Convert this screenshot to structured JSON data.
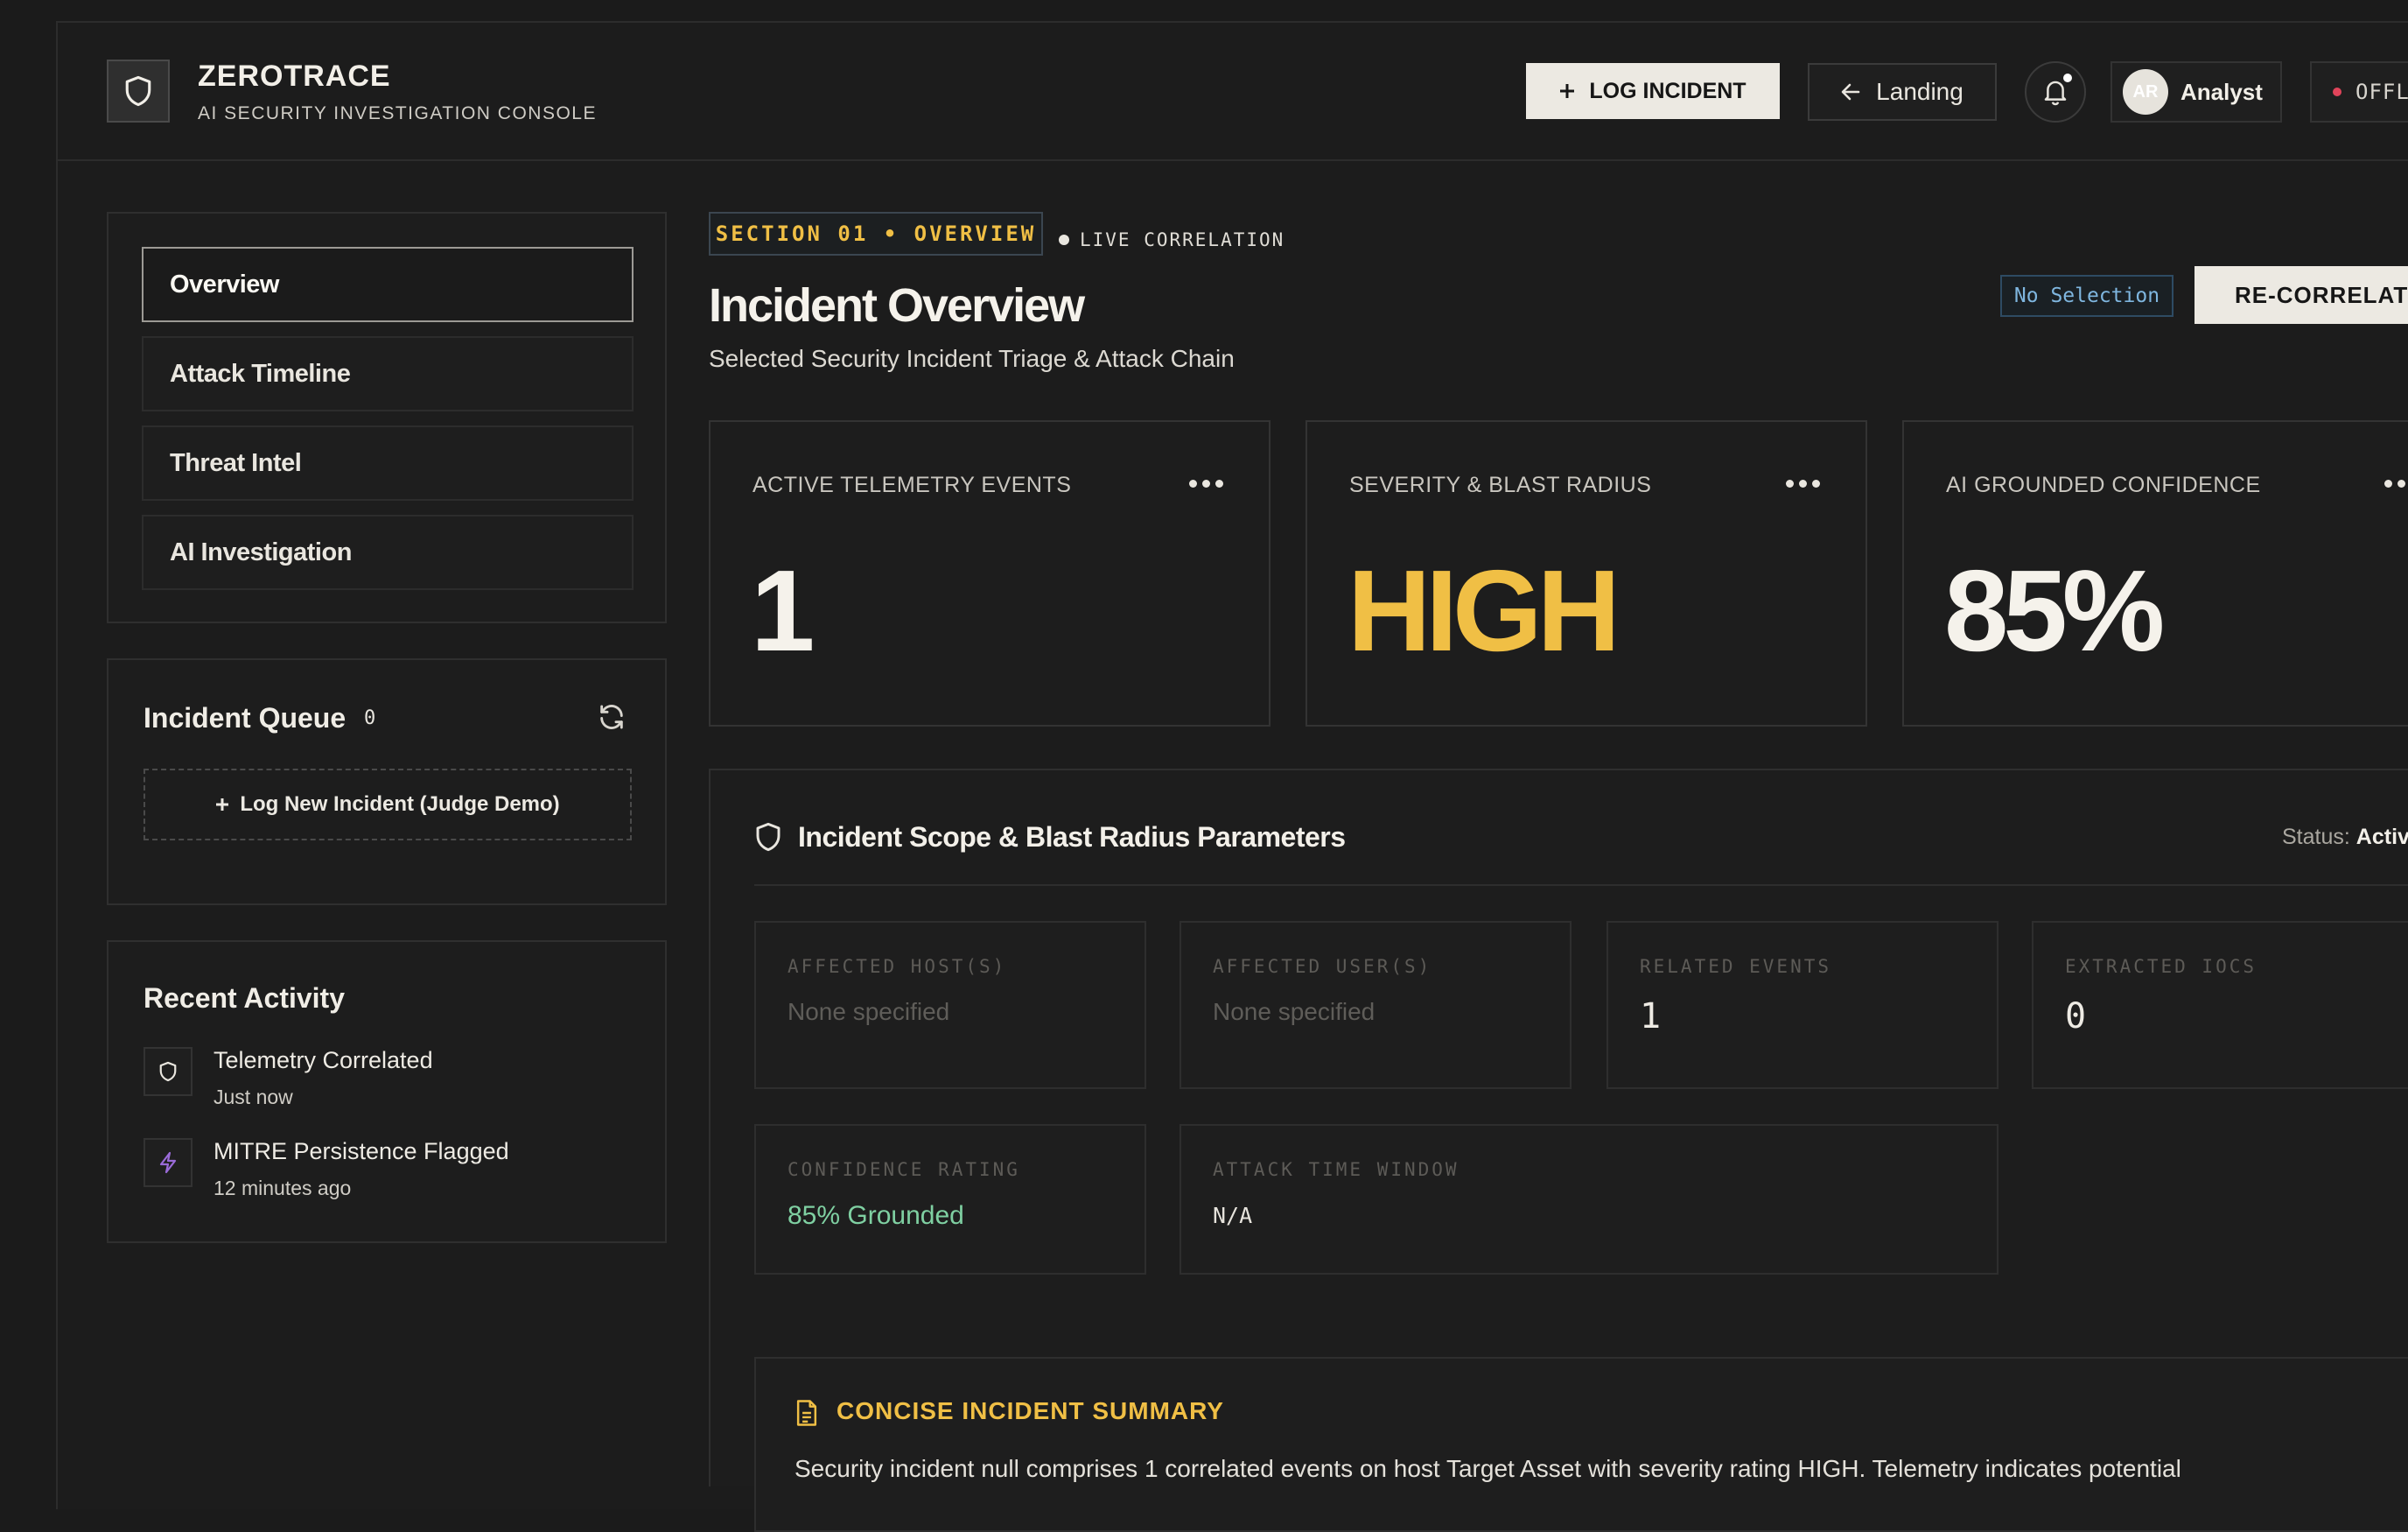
{
  "header": {
    "brand_title": "ZEROTRACE",
    "brand_subtitle": "AI SECURITY INVESTIGATION CONSOLE",
    "log_incident_label": "LOG INCIDENT",
    "landing_label": "Landing",
    "avatar_initials": "AR",
    "user_name": "Analyst",
    "status_label": "OFFLINE"
  },
  "sidebar": {
    "nav_items": [
      {
        "label": "Overview",
        "active": true
      },
      {
        "label": "Attack Timeline",
        "active": false
      },
      {
        "label": "Threat Intel",
        "active": false
      },
      {
        "label": "AI Investigation",
        "active": false
      }
    ],
    "queue": {
      "title": "Incident Queue",
      "count": "0",
      "add_label": "Log New Incident (Judge Demo)"
    },
    "activity": {
      "title": "Recent Activity",
      "items": [
        {
          "title": "Telemetry Correlated",
          "time": "Just now",
          "icon": "shield-icon"
        },
        {
          "title": "MITRE Persistence Flagged",
          "time": "12 minutes ago",
          "icon": "lightning-icon"
        }
      ]
    }
  },
  "main": {
    "section_tag": "SECTION 01 • OVERVIEW",
    "live_label": "LIVE CORRELATION",
    "title": "Incident Overview",
    "subtitle": "Selected Security Incident Triage & Attack Chain",
    "selection_badge": "No Selection",
    "recorrelate_label": "RE-CORRELATE",
    "stats": [
      {
        "label": "ACTIVE TELEMETRY EVENTS",
        "value": "1"
      },
      {
        "label": "SEVERITY & BLAST RADIUS",
        "value": "HIGH"
      },
      {
        "label": "AI GROUNDED CONFIDENCE",
        "value": "85%"
      }
    ],
    "scope": {
      "title": "Incident Scope & Blast Radius Parameters",
      "status_label": "Status:",
      "status_value": "Active",
      "params": [
        {
          "label": "AFFECTED HOST(S)",
          "value": "None specified"
        },
        {
          "label": "AFFECTED USER(S)",
          "value": "None specified"
        },
        {
          "label": "RELATED EVENTS",
          "value": "1"
        },
        {
          "label": "EXTRACTED IOCS",
          "value": "0"
        },
        {
          "label": "CONFIDENCE RATING",
          "value": "85% Grounded"
        },
        {
          "label": "ATTACK TIME WINDOW",
          "value": "N/A"
        }
      ]
    },
    "summary": {
      "title": "CONCISE INCIDENT SUMMARY",
      "text": "Security incident null comprises 1 correlated events on host Target Asset with severity rating HIGH. Telemetry indicates potential"
    }
  },
  "colors": {
    "accent_yellow": "#f0bf45",
    "grounded_green": "#7fd0a2",
    "status_red": "#e0445a",
    "selection_blue": "#7fb6df"
  }
}
